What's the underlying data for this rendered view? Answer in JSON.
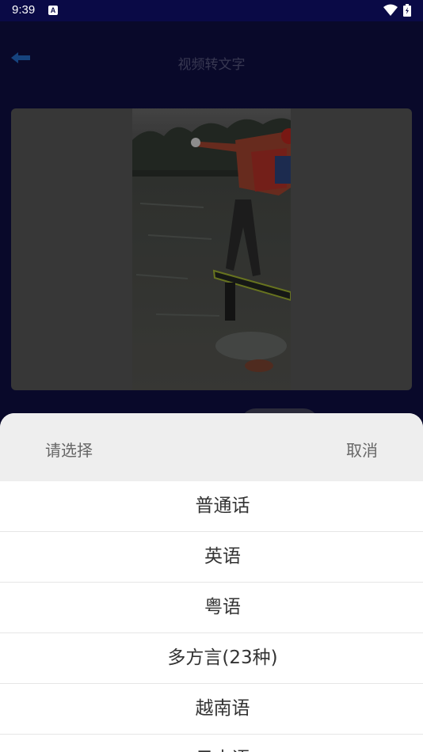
{
  "status_bar": {
    "time": "9:39",
    "notification_letter": "A",
    "wifi_icon": "wifi-icon",
    "battery_icon": "battery-icon"
  },
  "app": {
    "title": "视频转文字",
    "back_icon": "back-arrow-icon",
    "accent_color": "#1e5aa8"
  },
  "sheet": {
    "title": "请选择",
    "cancel_label": "取消",
    "options": [
      "普通话",
      "英语",
      "粤语",
      "多方言(23种)",
      "越南语",
      "日本语"
    ]
  }
}
